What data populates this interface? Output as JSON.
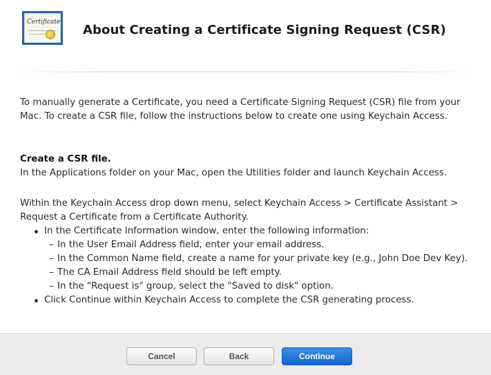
{
  "header": {
    "icon_text": "Certificate",
    "title": "About Creating a Certificate Signing Request (CSR)"
  },
  "content": {
    "intro": "To manually generate a Certificate, you need a Certificate Signing Request (CSR) file from your Mac. To create a CSR file, follow the instructions below to create one using Keychain Access.",
    "section_heading": "Create a CSR file.",
    "launch_text": "In the Applications folder on your Mac, open the Utilities folder and launch Keychain Access.",
    "menu_text": "Within the Keychain Access drop down menu, select Keychain Access > Certificate Assistant > Request a Certificate from a Certificate Authority.",
    "bullets": [
      {
        "text": "In the Certificate Information window, enter the following information:",
        "sub": [
          "In the User Email Address field, enter your email address.",
          "In the Common Name field, create a name for your private key (e.g., John Doe Dev Key).",
          "The CA Email Address field should be left empty.",
          "In the \"Request is\" group, select the \"Saved to disk\" option."
        ]
      },
      {
        "text": "Click Continue within Keychain Access to complete the CSR generating process."
      }
    ],
    "dash": "–"
  },
  "footer": {
    "cancel_label": "Cancel",
    "back_label": "Back",
    "continue_label": "Continue"
  }
}
